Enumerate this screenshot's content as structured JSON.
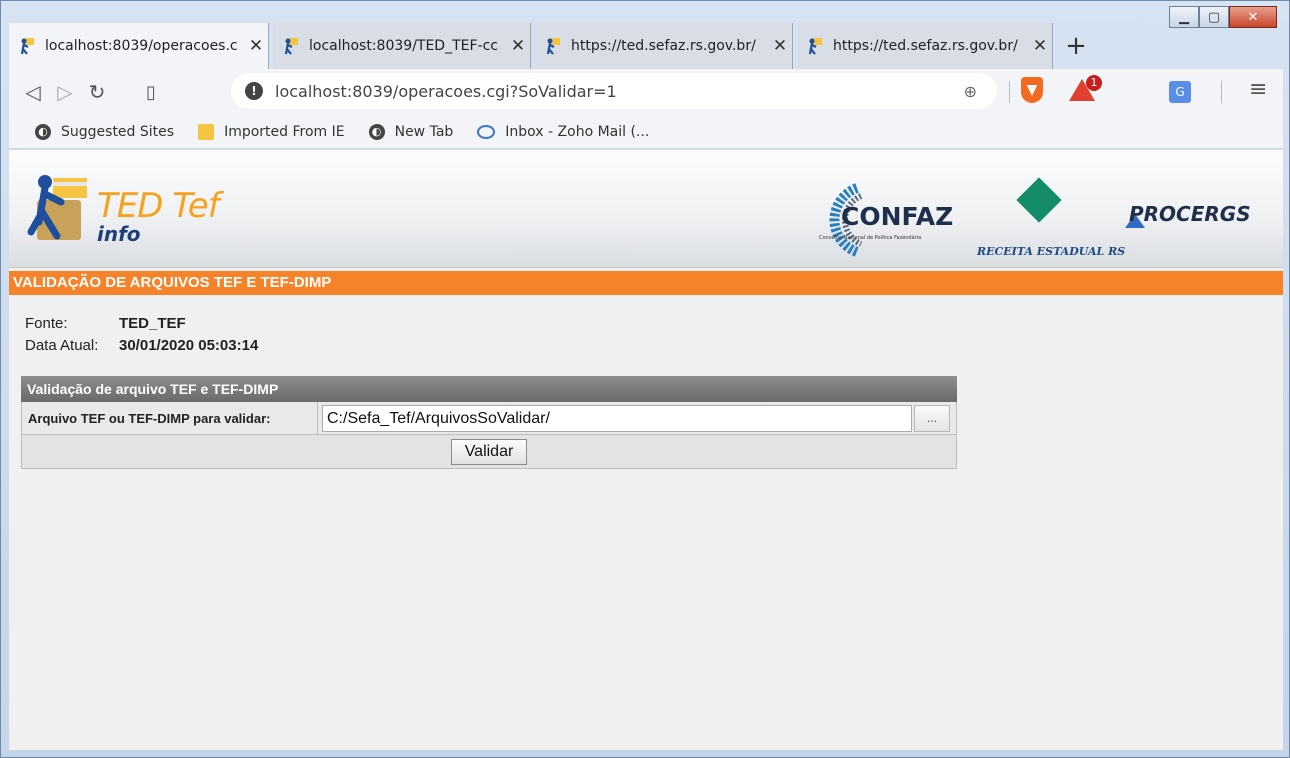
{
  "browser": {
    "tabs": [
      {
        "title": "localhost:8039/operacoes.c",
        "active": true
      },
      {
        "title": "localhost:8039/TED_TEF-cc",
        "active": false
      },
      {
        "title": "https://ted.sefaz.rs.gov.br/",
        "active": false
      },
      {
        "title": "https://ted.sefaz.rs.gov.br/",
        "active": false
      }
    ],
    "url": "localhost:8039/operacoes.cgi?SoValidar=1",
    "brave_badge": "1",
    "bookmarks": [
      "Suggested Sites",
      "Imported From IE",
      "New Tab",
      "Inbox - Zoho Mail (..."
    ]
  },
  "header": {
    "logo_title": "TED Tef",
    "logo_sub": "info",
    "confaz": "CONFAZ",
    "confaz_sub": "Conselho Nacional de Política Fazendária",
    "receita": "RECEITA ESTADUAL RS",
    "procergs": "PROCERGS"
  },
  "page": {
    "title": "VALIDAÇÃO DE ARQUIVOS TEF E TEF-DIMP",
    "fonte_label": "Fonte:",
    "fonte_value": "TED_TEF",
    "data_label": "Data Atual:",
    "data_value": "30/01/2020 05:03:14"
  },
  "panel": {
    "header": "Validação de arquivo TEF e TEF-DIMP",
    "file_label": "Arquivo TEF ou TEF-DIMP para validar:",
    "file_value": "C:/Sefa_Tef/ArquivosSoValidar/",
    "browse_label": "...",
    "submit_label": "Validar"
  },
  "colors": {
    "accent_orange": "#f5832a",
    "panel_header": "#7a7a7a"
  }
}
